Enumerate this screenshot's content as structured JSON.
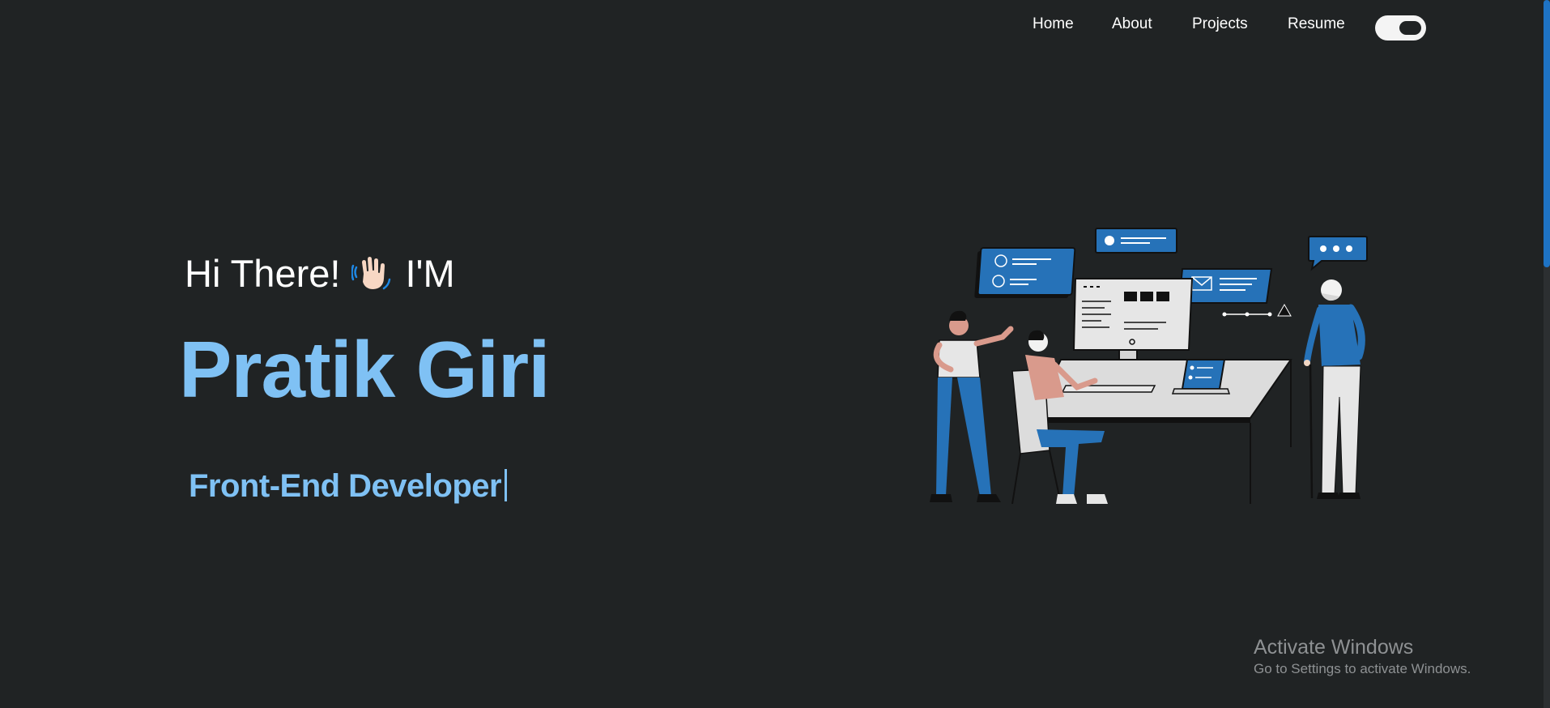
{
  "nav": {
    "items": [
      {
        "label": "Home"
      },
      {
        "label": "About"
      },
      {
        "label": "Projects"
      },
      {
        "label": "Resume"
      }
    ],
    "theme_toggle_icon": "toggle-switch-icon"
  },
  "hero": {
    "greeting_prefix": "Hi There!",
    "greeting_suffix": "I'M",
    "wave_icon": "waving-hand-icon",
    "name": "Pratik Giri",
    "role": "Front-End Developer",
    "illustration_icon": "team-working-at-computer-illustration"
  },
  "watermark": {
    "title": "Activate Windows",
    "subtitle": "Go to Settings to activate Windows."
  },
  "colors": {
    "background": "#202324",
    "accent": "#7fc1f4",
    "illustration_blue": "#2672b8",
    "nav_text": "#ffffff"
  }
}
